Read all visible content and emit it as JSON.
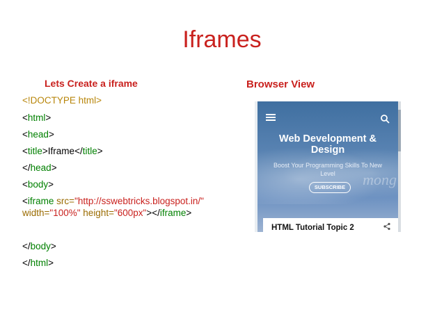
{
  "slide": {
    "title": "Iframes",
    "left_heading": "Lets Create a iframe",
    "right_heading": "Browser View"
  },
  "code": {
    "doctype": "<!DOCTYPE html>",
    "html_open": "html",
    "head_open": "head",
    "title_open": "title",
    "title_text": "Iframe",
    "title_close": "title",
    "head_close": "head",
    "body_open": "body",
    "iframe_tag": "iframe",
    "src_attr": "src=",
    "src_value": "\"http://sswebtricks.blogspot.in/\"",
    "width_attr": "width=",
    "width_value": "\"100%\"",
    "height_attr": "height=",
    "height_value": "\"600px\"",
    "iframe_close": "iframe",
    "body_close": "body",
    "html_close": "html"
  },
  "preview": {
    "site_title": "Web Development & Design",
    "tagline": "Boost Your Programming Skills To New Level",
    "subscribe_label": "SUBSCRIBE",
    "post_title": "HTML Tutorial Topic 2",
    "watermark": "mong"
  },
  "colors": {
    "accent": "#c9211e",
    "tag": "#008000",
    "doctype": "#b8860b"
  }
}
